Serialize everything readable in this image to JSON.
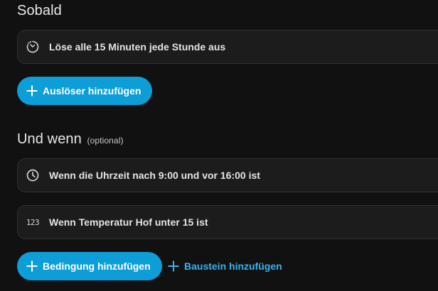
{
  "trigger_section": {
    "title": "Sobald",
    "items": [
      {
        "icon": "timer-pattern-icon",
        "label": "Löse alle 15 Minuten jede Stunde aus"
      }
    ],
    "add_button_label": "Auslöser hinzufügen"
  },
  "condition_section": {
    "title": "Und wenn",
    "optional_label": "(optional)",
    "items": [
      {
        "icon": "clock-icon",
        "label": "Wenn die Uhrzeit nach 9:00 und vor 16:00 ist"
      },
      {
        "icon": "numeric-icon",
        "icon_text": "123",
        "label": "Wenn Temperatur Hof unter 15 ist"
      }
    ],
    "add_button_label": "Bedingung hinzufügen",
    "add_block_label": "Baustein hinzufügen"
  },
  "colors": {
    "background": "#111111",
    "card": "#1c1c1c",
    "card_border": "#303030",
    "accent": "#0d9ed8",
    "link": "#36b3ee"
  }
}
